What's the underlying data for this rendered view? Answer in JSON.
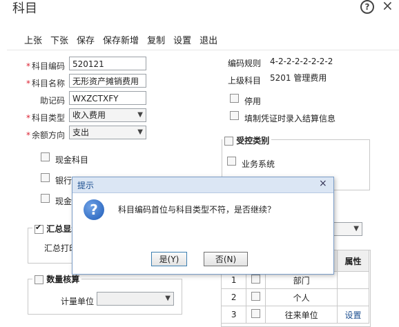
{
  "window": {
    "title": "科目"
  },
  "toolbar": [
    "上张",
    "下张",
    "保存",
    "保存新增",
    "复制",
    "设置",
    "退出"
  ],
  "form": {
    "code_label": "科目编码",
    "code_value": "520121",
    "name_label": "科目名称",
    "name_value": "无形资产摊销费用",
    "mnemonic_label": "助记码",
    "mnemonic_value": "WXZCTXFY",
    "type_label": "科目类型",
    "type_value": "收入费用",
    "balance_label": "余额方向",
    "balance_value": "支出",
    "rule_label": "编码规则",
    "rule_value": "4-2-2-2-2-2-2-2",
    "parent_label": "上级科目",
    "parent_value": "5201 管理费用",
    "disabled_label": "停用",
    "settle_label": "填制凭证时录入结算信息",
    "cash_label": "现金科目",
    "bank_label": "银行",
    "cash2_label": "现金"
  },
  "control_group": {
    "title": "受控类别",
    "business_label": "业务系统"
  },
  "summary_group": {
    "title": "汇总显示",
    "print_label": "汇总打印"
  },
  "quantity_group": {
    "title": "数量核算",
    "unit_label": "计量单位",
    "unit_value": ""
  },
  "table": {
    "header_attr": "属性",
    "rows": [
      {
        "num": "1",
        "name": "部门",
        "attr": ""
      },
      {
        "num": "2",
        "name": "个人",
        "attr": ""
      },
      {
        "num": "3",
        "name": "往来单位",
        "attr": "设置"
      }
    ]
  },
  "dialog": {
    "title": "提示",
    "message": "科目编码首位与科目类型不符，是否继续？",
    "yes_label": "是(Y)",
    "no_label": "否(N)"
  }
}
